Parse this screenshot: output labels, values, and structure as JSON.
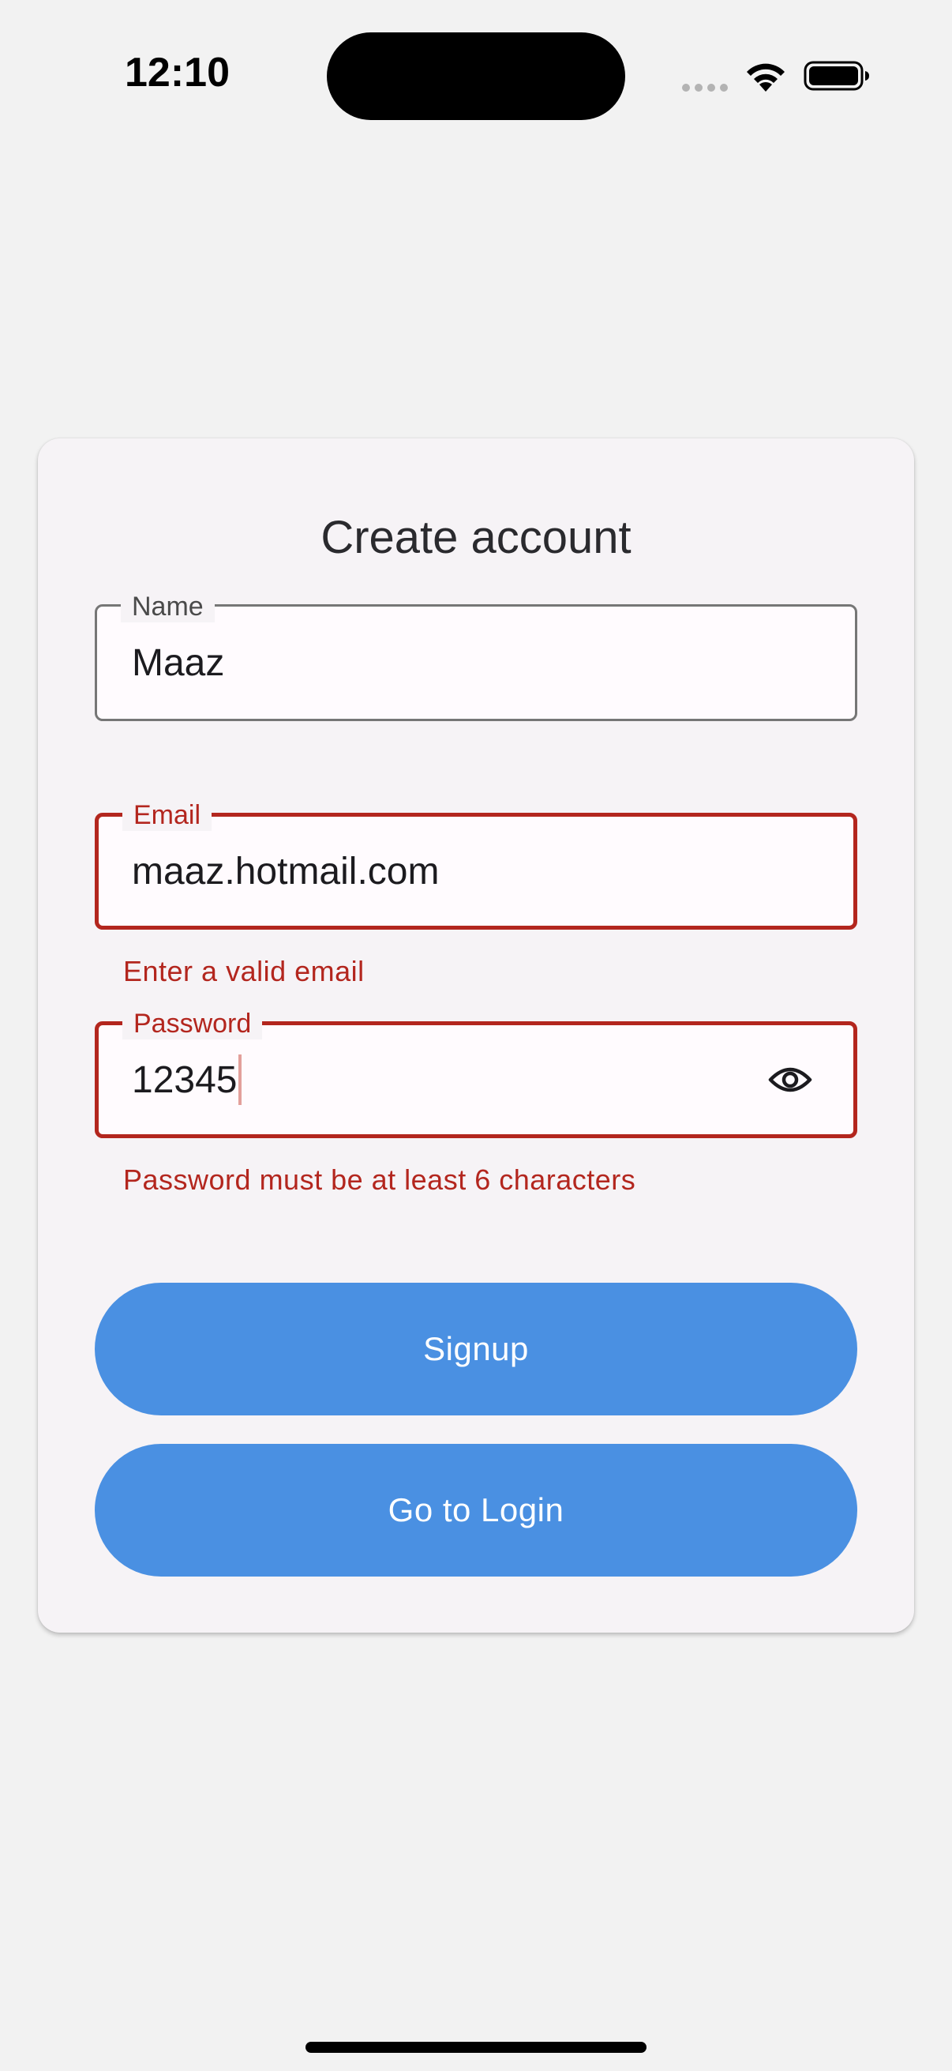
{
  "status_bar": {
    "time": "12:10"
  },
  "form": {
    "title": "Create account",
    "name": {
      "label": "Name",
      "value": "Maaz"
    },
    "email": {
      "label": "Email",
      "value": "maaz.hotmail.com",
      "error": "Enter a valid email"
    },
    "password": {
      "label": "Password",
      "value": "12345",
      "error": "Password must be at least 6 characters"
    },
    "signup_label": "Signup",
    "login_label": "Go to Login"
  },
  "colors": {
    "background": "#f2f2f2",
    "card": "#f6f3f6",
    "error": "#b3261e",
    "button": "#4a90e2"
  },
  "icons": {
    "wifi": "wifi-icon",
    "battery": "battery-icon",
    "password_toggle": "eye-icon"
  }
}
